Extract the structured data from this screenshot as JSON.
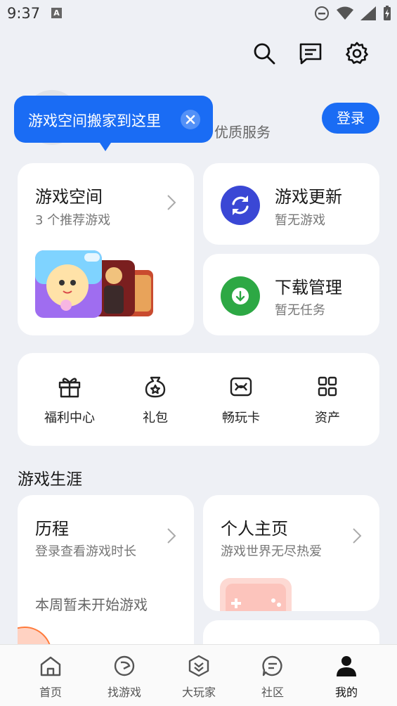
{
  "status_bar": {
    "time": "9:37",
    "notification_badge": "A"
  },
  "header": {
    "icons": [
      "search-icon",
      "message-icon",
      "settings-icon"
    ]
  },
  "login": {
    "subtitle": "优质服务",
    "button_label": "登录"
  },
  "tooltip": {
    "text": "游戏空间搬家到这里"
  },
  "game_space": {
    "title": "游戏空间",
    "subtitle": "3 个推荐游戏"
  },
  "game_update": {
    "title": "游戏更新",
    "subtitle": "暂无游戏"
  },
  "download": {
    "title": "下载管理",
    "subtitle": "暂无任务"
  },
  "quick_actions": [
    {
      "label": "福利中心",
      "icon": "gift-icon"
    },
    {
      "label": "礼包",
      "icon": "gift-bag-icon"
    },
    {
      "label": "畅玩卡",
      "icon": "play-card-icon"
    },
    {
      "label": "资产",
      "icon": "grid-icon"
    }
  ],
  "career": {
    "section_title": "游戏生涯",
    "history": {
      "title": "历程",
      "subtitle": "登录查看游戏时长",
      "note": "本周暂未开始游戏"
    },
    "profile": {
      "title": "个人主页",
      "subtitle": "游戏世界无尽热爱"
    }
  },
  "bottom_nav": [
    {
      "label": "首页",
      "icon": "home-icon"
    },
    {
      "label": "找游戏",
      "icon": "find-game-icon"
    },
    {
      "label": "大玩家",
      "icon": "player-icon"
    },
    {
      "label": "社区",
      "icon": "community-icon"
    },
    {
      "label": "我的",
      "icon": "me-icon",
      "active": true
    }
  ],
  "colors": {
    "accent": "#1a6cf4",
    "update_icon": "#3a47d5",
    "download_icon": "#2da844",
    "background": "#eef0f5"
  }
}
